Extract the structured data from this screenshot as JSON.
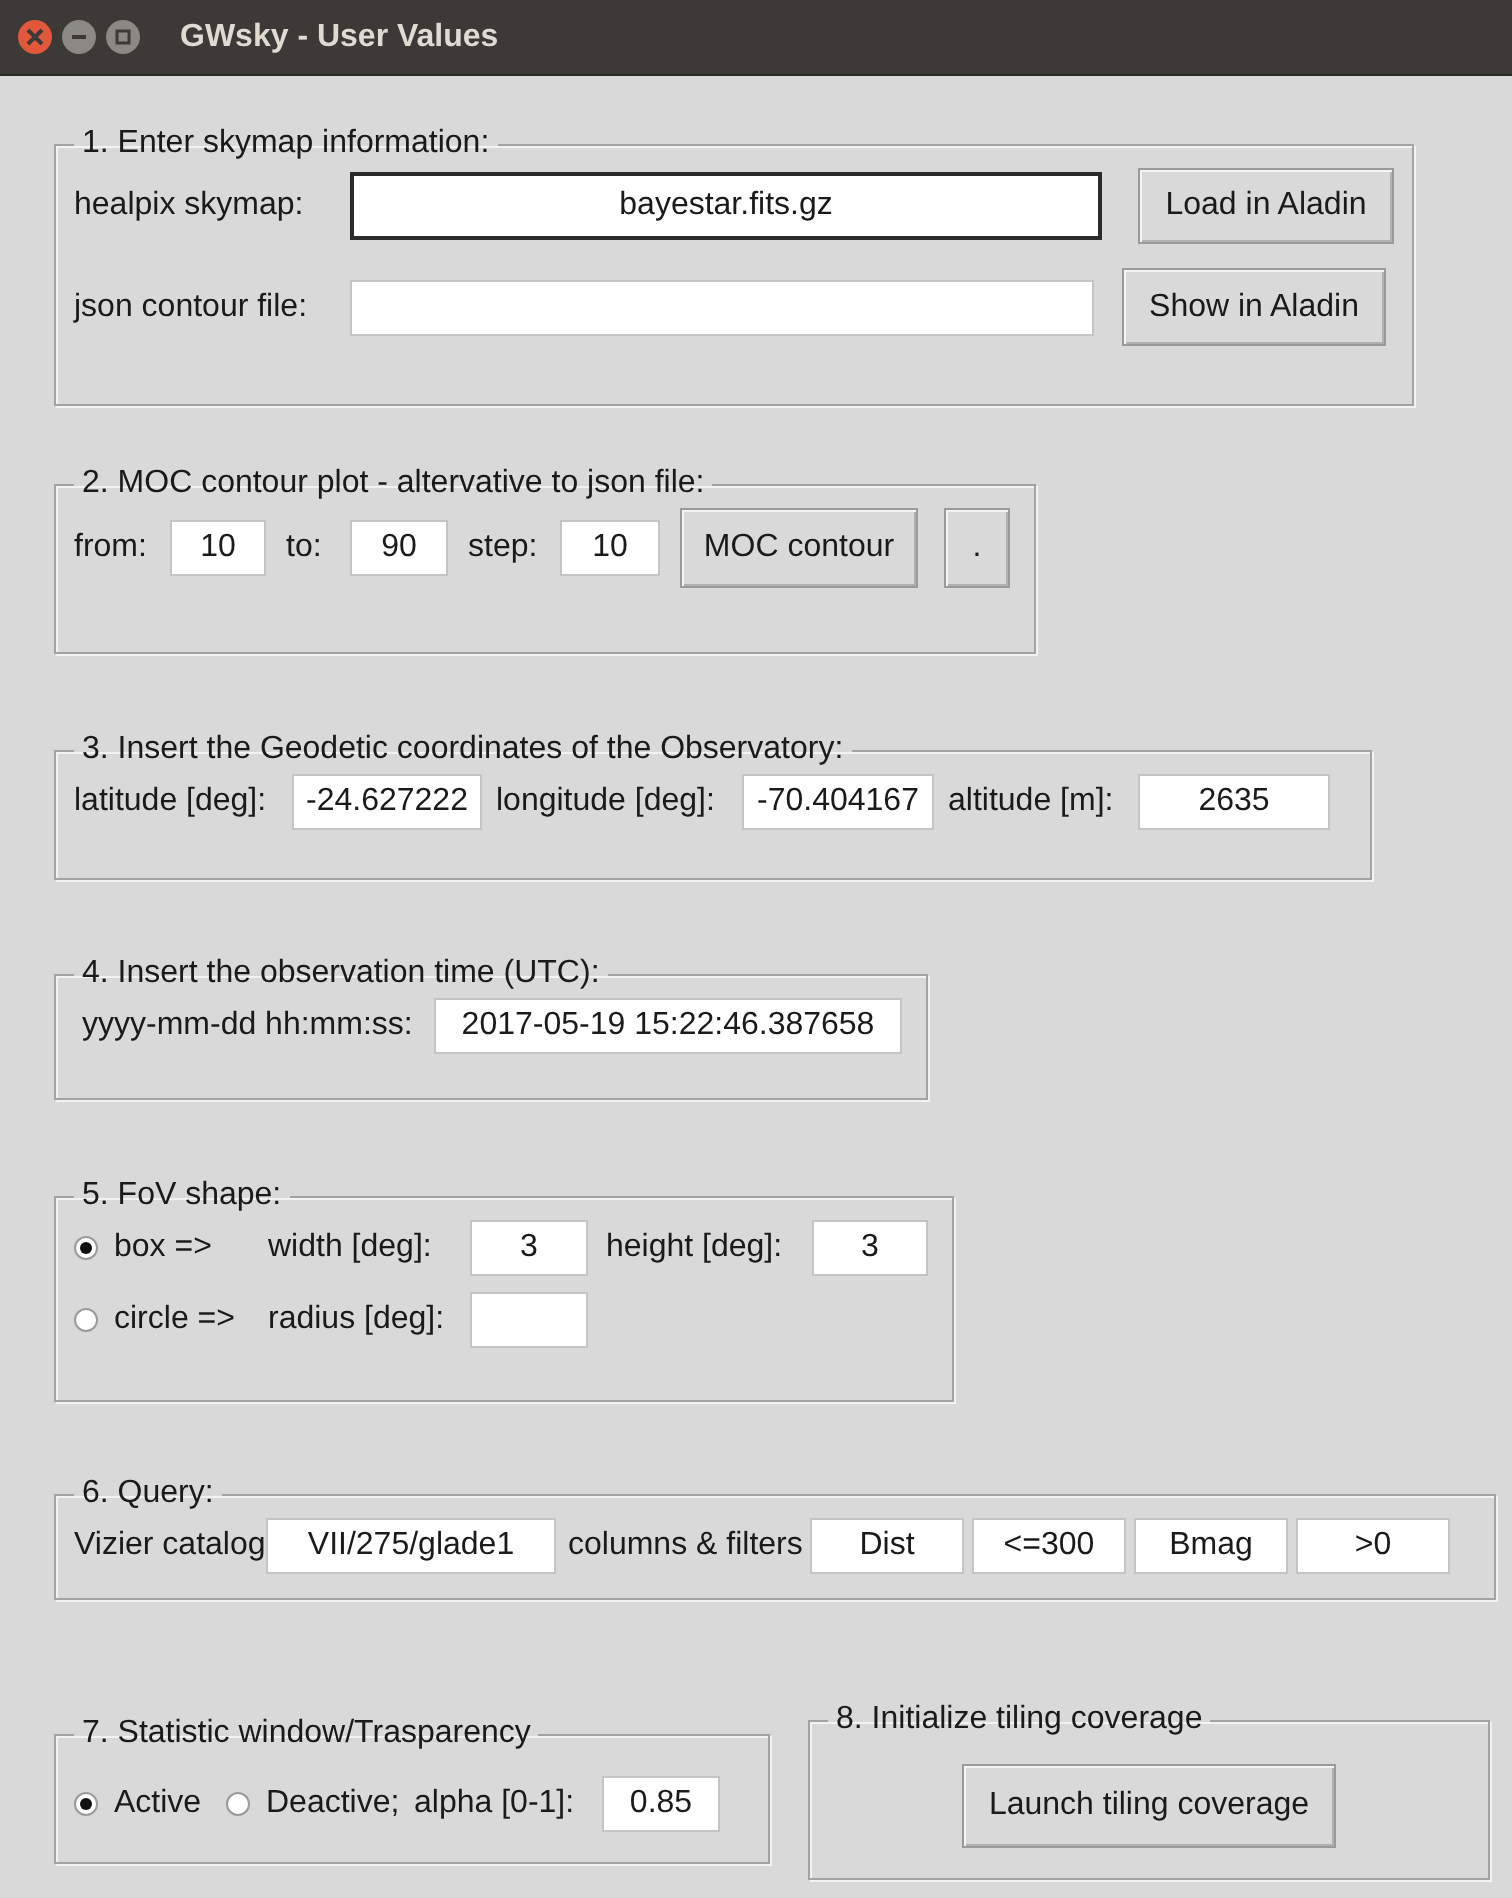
{
  "window": {
    "title": "GWsky - User Values"
  },
  "sections": [
    {
      "title": "1. Enter skymap information:",
      "rows": [
        [
          {
            "kind": "label",
            "text": "healpix skymap:"
          },
          {
            "kind": "entry",
            "value": "bayestar.fits.gz",
            "focused": true
          },
          {
            "kind": "button",
            "text": "Load in Aladin"
          }
        ],
        [
          {
            "kind": "label",
            "text": "json contour file:"
          },
          {
            "kind": "entry",
            "focused": false
          },
          {
            "kind": "button",
            "text": "Show in Aladin"
          }
        ]
      ]
    },
    {
      "title": "2. MOC contour plot - altervative to json file:",
      "rows": [
        [
          {
            "kind": "label",
            "text": "from:"
          },
          {
            "kind": "entry",
            "value": "10",
            "focused": false
          },
          {
            "kind": "label",
            "text": "to:"
          },
          {
            "kind": "entry",
            "value": "90",
            "focused": false
          },
          {
            "kind": "label",
            "text": "step:"
          },
          {
            "kind": "entry",
            "value": "10",
            "focused": false
          },
          {
            "kind": "button",
            "text": "MOC contour"
          },
          {
            "kind": "button",
            "text": "."
          }
        ]
      ]
    },
    {
      "title": "3. Insert the Geodetic coordinates of the Observatory:",
      "rows": [
        [
          {
            "kind": "label",
            "text": "latitude [deg]:"
          },
          {
            "kind": "entry",
            "value": "-24.627222",
            "focused": false
          },
          {
            "kind": "label",
            "text": "longitude [deg]:"
          },
          {
            "kind": "entry",
            "value": "-70.404167",
            "focused": false
          },
          {
            "kind": "label",
            "text": "altitude [m]:"
          },
          {
            "kind": "entry",
            "value": "2635",
            "focused": false
          }
        ]
      ]
    },
    {
      "title": "4. Insert the observation time (UTC):",
      "rows": [
        [
          {
            "kind": "label",
            "text": "yyyy-mm-dd hh:mm:ss:"
          },
          {
            "kind": "entry",
            "value": "2017-05-19 15:22:46.387658",
            "focused": false
          }
        ]
      ]
    },
    {
      "title": "5. FoV shape:",
      "rows": [
        [
          {
            "kind": "radio",
            "text": "box =>",
            "selected": true
          },
          {
            "kind": "label",
            "text": "width [deg]:"
          },
          {
            "kind": "entry",
            "value": "3",
            "focused": false
          },
          {
            "kind": "label",
            "text": "height [deg]:"
          },
          {
            "kind": "entry",
            "value": "3",
            "focused": false
          }
        ],
        [
          {
            "kind": "radio",
            "text": "circle =>",
            "selected": false
          },
          {
            "kind": "label",
            "text": "radius [deg]:"
          },
          {
            "kind": "entry",
            "focused": false
          }
        ]
      ]
    },
    {
      "title": "6. Query:",
      "rows": [
        [
          {
            "kind": "label",
            "text": "Vizier catalog"
          },
          {
            "kind": "entry",
            "value": "VII/275/glade1",
            "focused": false
          },
          {
            "kind": "label",
            "text": "columns & filters"
          },
          {
            "kind": "entry",
            "value": "Dist",
            "focused": false
          },
          {
            "kind": "entry",
            "value": "<=300",
            "focused": false
          },
          {
            "kind": "entry",
            "value": "Bmag",
            "focused": false
          },
          {
            "kind": "entry",
            "value": ">0",
            "focused": false
          }
        ]
      ]
    },
    {
      "title": "7. Statistic window/Trasparency",
      "rows": [
        [
          {
            "kind": "radio",
            "text": "Active",
            "selected": true
          },
          {
            "kind": "radio",
            "text": "Deactive;",
            "selected": false
          },
          {
            "kind": "label",
            "text": "alpha [0-1]:"
          },
          {
            "kind": "entry",
            "value": "0.85",
            "focused": false
          }
        ]
      ]
    },
    {
      "title": "8. Initialize tiling coverage",
      "rows": [
        [
          {
            "kind": "button",
            "text": "Launch tiling coverage"
          }
        ]
      ]
    }
  ]
}
